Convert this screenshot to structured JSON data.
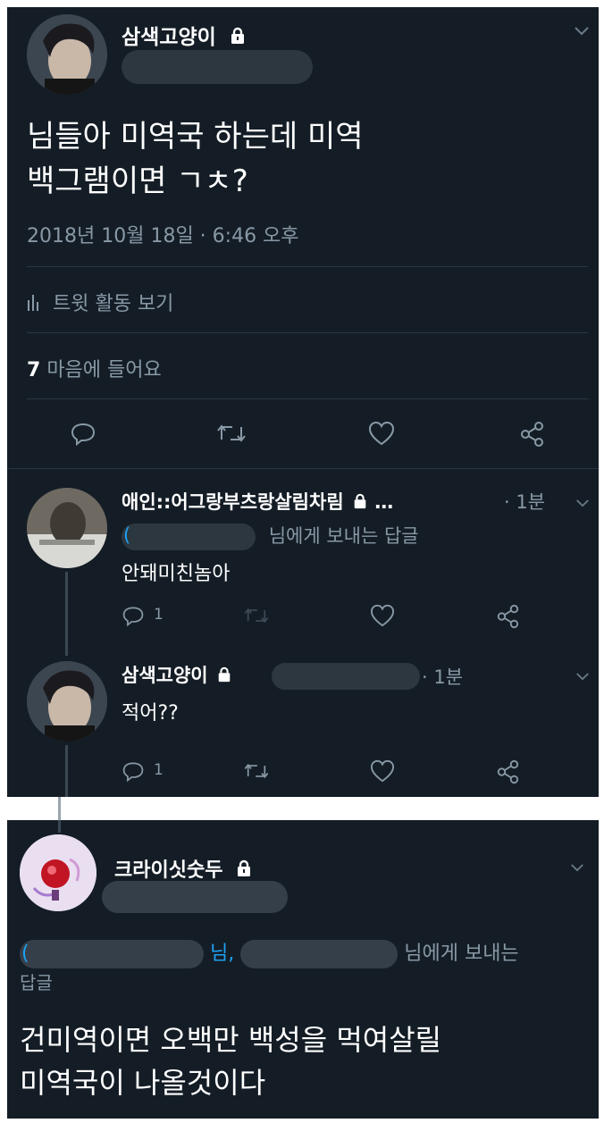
{
  "main_tweet": {
    "author": "삼색고양이",
    "text_line1": "님들아 미역국 하는데 미역",
    "text_line2": "백그램이면 ㄱㅊ?",
    "timestamp": "2018년 10월 18일 · 6:46 오후",
    "activity_label": "트윗 활동 보기",
    "likes_count": "7",
    "likes_label": "마음에 들어요"
  },
  "replies": [
    {
      "author": "애인::어그랑부츠랑살림차림",
      "ellipsis": "…",
      "time": "· 1분",
      "reply_to_suffix": "님에게 보내는 답글",
      "text": "안돼미친놈아",
      "reply_count": "1"
    },
    {
      "author": "삼색고양이",
      "time": "· 1분",
      "text": "적어??",
      "reply_count": "1"
    }
  ],
  "second_tweet": {
    "author": "크라이싯숫두",
    "reply_mid": "님,",
    "reply_suffix": "님에게 보내는",
    "reply_suffix2": "답글",
    "text_line1": "건미역이면 오백만 백성을 먹여살릴",
    "text_line2": "미역국이 나올것이다"
  },
  "colors": {
    "background": "#141d26",
    "muted": "#8899a6",
    "link": "#1da1f2",
    "divider": "#2a3743"
  },
  "icons": [
    "lock-icon",
    "chevron-down-icon",
    "bar-chart-icon",
    "reply-icon",
    "retweet-icon",
    "heart-icon",
    "share-icon"
  ]
}
